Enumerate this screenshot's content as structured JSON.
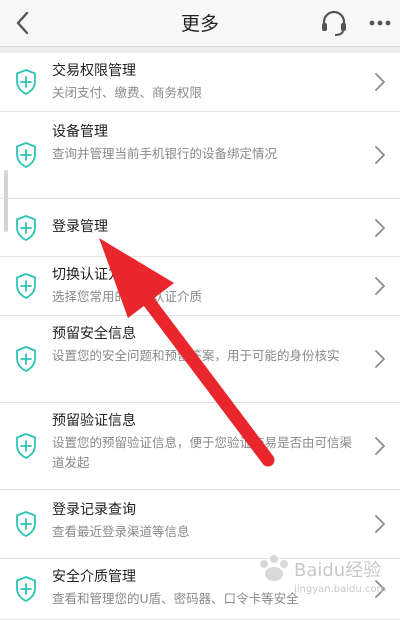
{
  "header": {
    "title": "更多"
  },
  "items": [
    {
      "title": "交易权限管理",
      "subtitle": "关闭支付、缴费、商务权限"
    },
    {
      "title": "设备管理",
      "subtitle": "查询并管理当前手机银行的设备绑定情况"
    },
    {
      "title": "登录管理",
      "subtitle": ""
    },
    {
      "title": "切换认证方式",
      "subtitle": "选择您常用的安全认证介质"
    },
    {
      "title": "预留安全信息",
      "subtitle": "设置您的安全问题和预留答案，用于可能的身份核实"
    },
    {
      "title": "预留验证信息",
      "subtitle": "设置您的预留验证信息，便于您验证交易是否由可信渠道发起"
    },
    {
      "title": "登录记录查询",
      "subtitle": "查看最近登录渠道等信息"
    },
    {
      "title": "安全介质管理",
      "subtitle": "查看和管理您的U盾、密码器、口令卡等安全"
    }
  ],
  "watermark": {
    "text": "Baidu经验",
    "url": "jingyan.baidu.com"
  },
  "colors": {
    "icon": "#2cc4b4",
    "annotation_arrow": "#e8262b"
  }
}
